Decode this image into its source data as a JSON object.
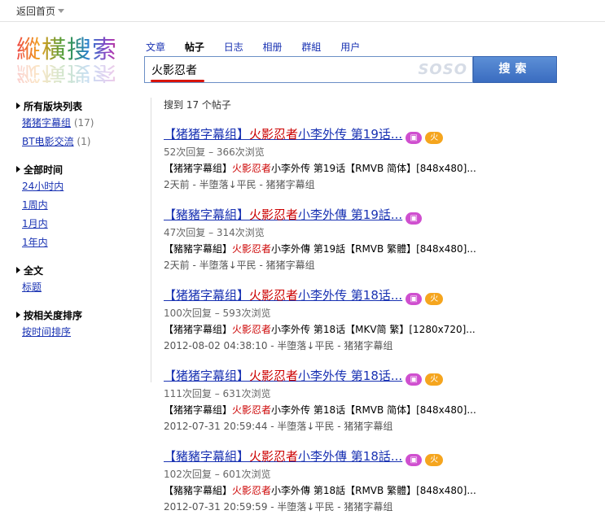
{
  "topbar": {
    "back_label": "返回首页"
  },
  "logo": {
    "text": "縱橫搜索"
  },
  "tabs": [
    {
      "label": "文章"
    },
    {
      "label": "帖子"
    },
    {
      "label": "日志"
    },
    {
      "label": "相册"
    },
    {
      "label": "群組"
    },
    {
      "label": "用户"
    }
  ],
  "search": {
    "value": "火影忍者",
    "brand": "SOSO",
    "button_label": "搜索"
  },
  "sidebar": {
    "groups": [
      {
        "title": "所有版块列表",
        "items": [
          {
            "label": "猪猪字幕组",
            "count": "(17)"
          },
          {
            "label": "BT电影交流",
            "count": "(1)"
          }
        ]
      },
      {
        "title": "全部时间",
        "items": [
          {
            "label": "24小时内"
          },
          {
            "label": "1周内"
          },
          {
            "label": "1月内"
          },
          {
            "label": "1年内"
          }
        ]
      },
      {
        "title": "全文",
        "items": [
          {
            "label": "标题"
          }
        ]
      },
      {
        "title": "按相关度排序",
        "items": [
          {
            "label": "按时间排序"
          }
        ]
      }
    ]
  },
  "results": {
    "summary": "搜到 17 个帖子",
    "items": [
      {
        "title_pre": "【猪猪字幕组】",
        "title_hl": "火影忍者",
        "title_post": "小李外传 第19话...",
        "meta": "52次回复 – 366次浏览",
        "snip_pre": "【猪猪字幕组】",
        "snip_hl": "火影忍者",
        "snip_post": "小李外传 第19话【RMVB 简体】[848x480]...",
        "src": "2天前 - 半堕落↓平民 - 猪猪字幕组"
      },
      {
        "title_pre": "【豬豬字幕組】",
        "title_hl": "火影忍者",
        "title_post": "小李外傳 第19話...",
        "meta": "47次回复 – 314次浏览",
        "snip_pre": "【豬豬字幕組】",
        "snip_hl": "火影忍者",
        "snip_post": "小李外傳 第19話【RMVB 繁體】[848x480]...",
        "src": "2天前 - 半堕落↓平民 - 猪猪字幕组"
      },
      {
        "title_pre": "【猪猪字幕组】",
        "title_hl": "火影忍者",
        "title_post": "小李外传 第18话...",
        "meta": "100次回复 – 593次浏览",
        "snip_pre": "【猪猪字幕组】",
        "snip_hl": "火影忍者",
        "snip_post": "小李外传 第18话【MKV简 繁】[1280x720]...",
        "src": "2012-08-02 04:38:10 - 半堕落↓平民 - 猪猪字幕组"
      },
      {
        "title_pre": "【猪猪字幕组】",
        "title_hl": "火影忍者",
        "title_post": "小李外传 第18话...",
        "meta": "111次回复 – 631次浏览",
        "snip_pre": "【猪猪字幕组】",
        "snip_hl": "火影忍者",
        "snip_post": "小李外传 第18话【RMVB 简体】[848x480]...",
        "src": "2012-07-31 20:59:44 - 半堕落↓平民 - 猪猪字幕组"
      },
      {
        "title_pre": "【豬豬字幕組】",
        "title_hl": "火影忍者",
        "title_post": "小李外傳 第18話...",
        "meta": "102次回复 – 601次浏览",
        "snip_pre": "【豬豬字幕組】",
        "snip_hl": "火影忍者",
        "snip_post": "小李外傳 第18話【RMVB 繁體】[848x480]...",
        "src": "2012-07-31 20:59:59 - 半堕落↓平民 - 猪猪字幕组"
      }
    ]
  },
  "icons": {
    "pic_badge": "picture-badge-icon",
    "fire_badge": "hot-badge-icon"
  },
  "colors": {
    "link": "#1a33b3",
    "highlight": "#cc0000",
    "button": "#3a6cc0",
    "pic_badge": "#cf4fcf",
    "hot_badge": "#f5a51e"
  }
}
